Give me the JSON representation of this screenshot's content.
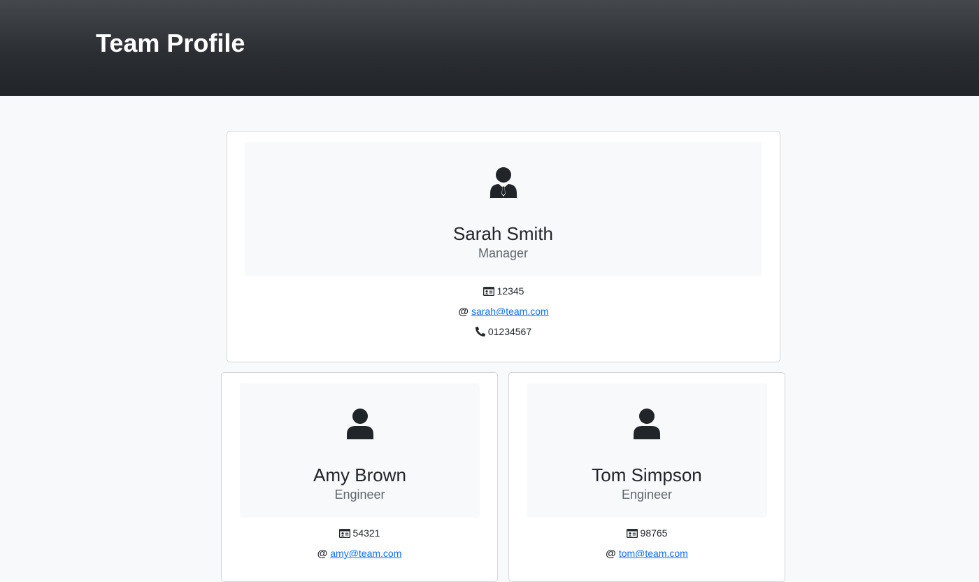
{
  "header": {
    "title": "Team Profile"
  },
  "team": [
    {
      "name": "Sarah Smith",
      "role": "Manager",
      "id": "12345",
      "email": "sarah@team.com",
      "phone": "01234567"
    },
    {
      "name": "Amy Brown",
      "role": "Engineer",
      "id": "54321",
      "email": "amy@team.com"
    },
    {
      "name": "Tom Simpson",
      "role": "Engineer",
      "id": "98765",
      "email": "tom@team.com"
    }
  ],
  "icons": {
    "manager": "user-tie-icon",
    "engineer": "user-icon",
    "id": "id-card-icon",
    "email": "at-icon",
    "phone": "phone-icon"
  },
  "colors": {
    "header_top": "#45484c",
    "header_bottom": "#212429",
    "link": "#0d6efd",
    "page_bg": "#f8f9fa"
  }
}
